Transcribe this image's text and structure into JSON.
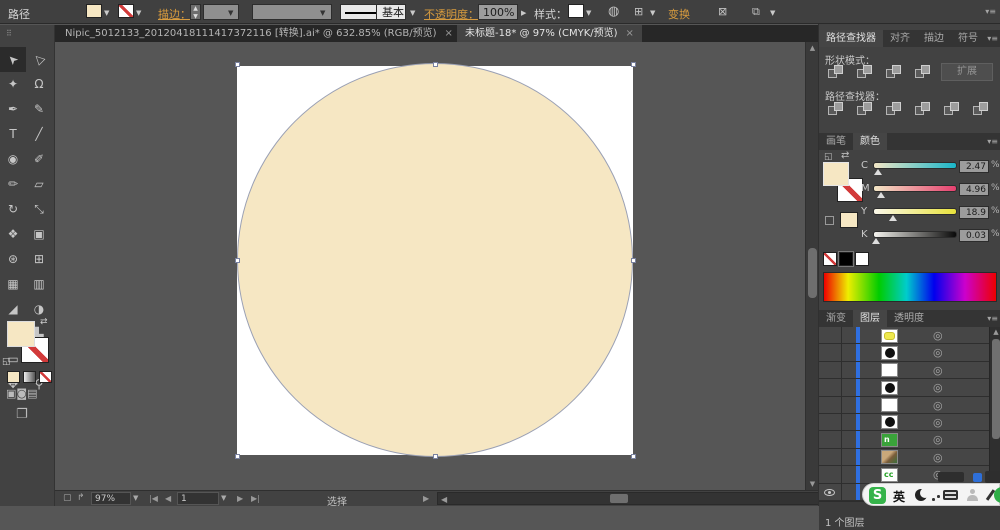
{
  "app": {
    "accent_orange": "#d79b3e",
    "fill_color": "#f6e7c3",
    "selection_blue": "#2f6fe0"
  },
  "control_bar": {
    "context_label": "路径",
    "stroke_label": "描边：",
    "stroke_style_basic": "基本",
    "opacity_label": "不透明度：",
    "opacity_value": "100%",
    "style_label": "样式：",
    "transform_label": "变换",
    "panel_menu_icon": "▾≡"
  },
  "doc_tabs": [
    {
      "title": "Nipic_5012133_20120418111417372116 [转换].ai* @ 632.85% (RGB/预览)",
      "close": "×",
      "active": false
    },
    {
      "title": "未标题-18* @ 97% (CMYK/预览)",
      "close": "×",
      "active": true
    }
  ],
  "tools": {
    "rows": [
      {
        "l": {
          "name": "selection-tool",
          "glyph": "➤",
          "rot": true,
          "active": true
        },
        "r": {
          "name": "direct-selection-tool",
          "glyph": "▷",
          "rot": true
        }
      },
      {
        "l": {
          "name": "magic-wand-tool",
          "glyph": "✦"
        },
        "r": {
          "name": "lasso-tool",
          "glyph": "Ω"
        }
      },
      {
        "l": {
          "name": "pen-tool",
          "glyph": "✒"
        },
        "r": {
          "name": "curvature-tool",
          "glyph": "✎"
        }
      },
      {
        "l": {
          "name": "type-tool",
          "glyph": "T"
        },
        "r": {
          "name": "line-segment-tool",
          "glyph": "╱"
        }
      },
      {
        "l": {
          "name": "shape-tool",
          "glyph": "◉"
        },
        "r": {
          "name": "paintbrush-tool",
          "glyph": "✐"
        }
      },
      {
        "l": {
          "name": "pencil-tool",
          "glyph": "✏"
        },
        "r": {
          "name": "eraser-tool",
          "glyph": "▱"
        }
      },
      {
        "l": {
          "name": "rotate-tool",
          "glyph": "↻"
        },
        "r": {
          "name": "scale-tool",
          "glyph": "⤡"
        }
      },
      {
        "l": {
          "name": "width-tool",
          "glyph": "❖"
        },
        "r": {
          "name": "free-transform-tool",
          "glyph": "▣"
        }
      },
      {
        "l": {
          "name": "shape-builder-tool",
          "glyph": "⊛"
        },
        "r": {
          "name": "perspective-grid-tool",
          "glyph": "⊞"
        }
      },
      {
        "l": {
          "name": "mesh-tool",
          "glyph": "▦"
        },
        "r": {
          "name": "gradient-tool",
          "glyph": "▥"
        }
      },
      {
        "l": {
          "name": "eyedropper-tool",
          "glyph": "◢"
        },
        "r": {
          "name": "blend-tool",
          "glyph": "◑"
        }
      },
      {
        "l": {
          "name": "symbol-sprayer-tool",
          "glyph": "❉"
        },
        "r": {
          "name": "column-graph-tool",
          "glyph": "▙"
        }
      },
      {
        "l": {
          "name": "artboard-tool",
          "glyph": "▭"
        },
        "r": {
          "name": "slice-tool",
          "glyph": "✂"
        }
      },
      {
        "l": {
          "name": "hand-tool",
          "glyph": "✥"
        },
        "r": {
          "name": "zoom-tool",
          "glyph": "⚲"
        }
      }
    ],
    "mode_icons": [
      "▣",
      "◙",
      "▤"
    ],
    "screen_mode_icon": "❐"
  },
  "panels": {
    "pathfinder": {
      "tabs": [
        "路径查找器",
        "对齐",
        "描边",
        "符号"
      ],
      "active_tab": 0,
      "shape_modes_label": "形状模式：",
      "shape_mode_icons": [
        "unite",
        "minus-front",
        "intersect",
        "exclude"
      ],
      "expand_button": "扩展",
      "pathfinder_label": "路径查找器：",
      "pathfinder_icons": [
        "divide",
        "trim",
        "merge",
        "crop",
        "outline",
        "minus-back"
      ]
    },
    "color": {
      "tabs": [
        "画笔",
        "颜色"
      ],
      "active_tab": 1,
      "unit": "%",
      "channels": [
        {
          "label": "C",
          "value": "2.47",
          "knob_pct": 5
        },
        {
          "label": "M",
          "value": "4.96",
          "knob_pct": 8
        },
        {
          "label": "Y",
          "value": "18.9",
          "knob_pct": 23
        },
        {
          "label": "K",
          "value": "0.03",
          "knob_pct": 2
        }
      ]
    },
    "layers": {
      "tabs": [
        "渐变",
        "图层",
        "透明度"
      ],
      "active_tab": 1,
      "status": "1 个图层",
      "rows": [
        {
          "thumb": "yellow"
        },
        {
          "thumb": "black-circle"
        },
        {
          "thumb": "white"
        },
        {
          "thumb": "black-circle"
        },
        {
          "thumb": "white"
        },
        {
          "thumb": "black-circle"
        },
        {
          "thumb": "green-logo",
          "label": "n"
        },
        {
          "thumb": "photo"
        },
        {
          "thumb": "green-cc",
          "label": "cc"
        },
        {
          "thumb": "cream",
          "eye": true
        }
      ]
    }
  },
  "status_bar": {
    "zoom": "97%",
    "page": "1",
    "tool": "选择"
  },
  "ime_bar": {
    "logo": "S",
    "lang": "英"
  }
}
